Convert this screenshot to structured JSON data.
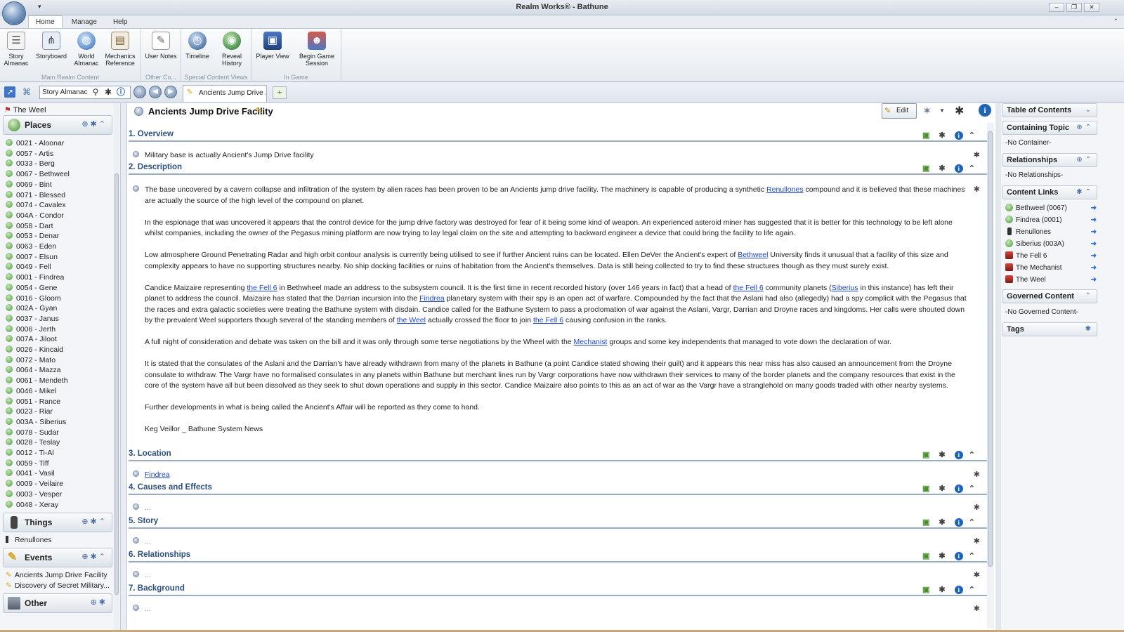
{
  "window": {
    "title": "Realm Works® - Bathune",
    "qat": "▾",
    "controls": [
      "–",
      "❐",
      "✕"
    ]
  },
  "ribbon": {
    "tabs": [
      "Home",
      "Manage",
      "Help"
    ],
    "groups": [
      {
        "label": "Main Realm Content",
        "buttons": [
          "Story Almanac",
          "Storyboard",
          "World Almanac",
          "Mechanics Reference"
        ]
      },
      {
        "label": "Other Co...",
        "buttons": [
          "User Notes"
        ]
      },
      {
        "label": "Special Content Views",
        "buttons": [
          "Timeline",
          "Reveal History"
        ]
      },
      {
        "label": "In Game",
        "buttons": [
          "Player View",
          "Begin Game Session"
        ]
      }
    ]
  },
  "nav": {
    "search_value": "Story Almanac",
    "doc_tab": "Ancients Jump Drive ..."
  },
  "left": {
    "root": "The Weel",
    "places_header": "Places",
    "places": [
      "0021 - Aloonar",
      "0057 - Artis",
      "0033 - Berg",
      "0067 - Bethweel",
      "0069 - Bint",
      "0071 - Blessed",
      "0074 - Cavalex",
      "004A - Condor",
      "0058 - Dart",
      "0053 - Denar",
      "0063 - Eden",
      "0007 - Elsun",
      "0049 - Fell",
      "0001 - Findrea",
      "0054 - Gene",
      "0016 - Gloom",
      "002A - Gyan",
      "0037 - Janus",
      "0006 - Jerth",
      "007A - Jiloot",
      "0026 - Kincaid",
      "0072 - Mato",
      "0064 - Mazza",
      "0061 - Mendeth",
      "0046 - Mikel",
      "0051 - Rance",
      "0023 - Riar",
      "003A - Siberius",
      "0078 - Sudar",
      "0028 - Teslay",
      "0012 - Ti-Al",
      "0059 - Tiff",
      "0041 - Vasil",
      "0009 - Veilaire",
      "0003 - Vesper",
      "0048 - Xeray"
    ],
    "things_header": "Things",
    "things": [
      "Renullones"
    ],
    "events_header": "Events",
    "events": [
      "Ancients Jump Drive Facility",
      "Discovery of Secret Military..."
    ],
    "other_header": "Other"
  },
  "topic": {
    "title": "Ancients Jump Drive Facility",
    "edit_label": "Edit",
    "sections": {
      "overview": {
        "title": "1. Overview",
        "text": "Military base is actually Ancient's Jump Drive facility"
      },
      "description": {
        "title": "2. Description"
      },
      "location": {
        "title": "3. Location",
        "link": "Findrea"
      },
      "causes": {
        "title": "4. Causes and Effects",
        "text": "..."
      },
      "story": {
        "title": "5. Story",
        "text": "..."
      },
      "relationships": {
        "title": "6. Relationships",
        "text": "..."
      },
      "background": {
        "title": "7. Background",
        "text": "..."
      }
    },
    "description": {
      "p1a": "The base uncovered by a cavern collapse and infiltration of the system by alien races has been proven to be an Ancients jump drive facility.  The machinery is capable of producing a synthetic ",
      "p1link": "Renullones",
      "p1b": " compound and it is believed that these machines are actually the source of the high level of the compound on planet.",
      "p2": "In the espionage that was uncovered it appears that the control device for the jump drive factory was destroyed for fear of it being some kind of weapon.  An experienced asteroid miner has suggested that it is better for this technology to be left alone whilst companies, including the owner of the Pegasus mining platform are now trying to lay legal claim on the site and attempting to backward engineer a device that could bring the facility to life again.",
      "p3a": "Low atmosphere Ground Penetrating Radar and high orbit contour analysis is currently being utilised to see if further Ancient ruins can be located.  Ellen DeVer the Ancient's expert of ",
      "p3link": "Bethweel",
      "p3b": " University finds it unusual that a facility of this size and complexity appears to have no supporting structures nearby.  No ship docking facilities or ruins of habitation from the Ancient's themselves.  Data is still being collected to try to find these structures though as they must surely exist.",
      "p4a": "Candice Maizaire representing ",
      "p4l1": "the Fell 6",
      "p4b": " in Bethwheel made an address to the subsystem council.  It is the first time in recent recorded history (over 146 years in fact) that a head of ",
      "p4l2": "the Fell 6",
      "p4c": " community planets (",
      "p4l3": "Siberius",
      "p4d": " in this instance) has left their planet to address the council.  Maizaire has stated that the Darrian incursion into the ",
      "p4l4": "Findrea",
      "p4e": " planetary system with their spy is an open act of warfare.  Compounded by the fact that the Aslani had also (allegedly) had a spy complicit with the Pegasus that the races and extra galactic societies were treating the Bathune system with disdain.  Candice called for the Bathune System to pass a proclomation of war against the Aslani, Vargr, Darrian and Droyne races and kingdoms.  Her calls were shouted down by the prevalent Weel supporters though several of the standing members of ",
      "p4l5": "the Weel",
      "p4f": " actually crossed the floor to join ",
      "p4l6": "the Fell 6",
      "p4g": " causing confusion in the ranks.",
      "p5a": "A full night of consideration and debate was taken on the bill and it was only through some terse negotiations by the Wheel with the ",
      "p5link": "Mechanist",
      "p5b": " groups and some key independents that managed to vote down the declaration of war.",
      "p6": "It is stated that the consulates of the Aslani and the Darrian's have already withdrawn from many of the planets in Bathune (a point Candice stated showing their guilt) and it appears this near miss has also caused an announcement from the Droyne consulate to withdraw.  The Vargr have no formalised consulates in any planets within Bathune but merchant lines run by Vargr corporations have now withdrawn their services to many of the border planets and the company resources that exist in the core of the system have all but been dissolved as they seek to shut down operations and supply in this sector.  Candice Maizaire also points to this as an act of war as the Vargr have a stranglehold on many goods traded with other nearby systems.",
      "p7": "Further developments in what is being called the Ancient's Affair will be reported as they come to hand.",
      "p8": "Keg Veillor _ Bathune System News"
    }
  },
  "right": {
    "toc": "Table of Contents",
    "containing": "Containing Topic",
    "no_container": "-No Container-",
    "relationships": "Relationships",
    "no_relationships": "-No Relationships-",
    "content_links": "Content Links",
    "links": [
      "Bethweel (0067)",
      "Findrea (0001)",
      "Renullones",
      "Siberius (003A)",
      "The Fell 6",
      "The Mechanist",
      "The Weel"
    ],
    "governed": "Governed Content",
    "no_governed": "-No Governed Content-",
    "tags": "Tags"
  }
}
